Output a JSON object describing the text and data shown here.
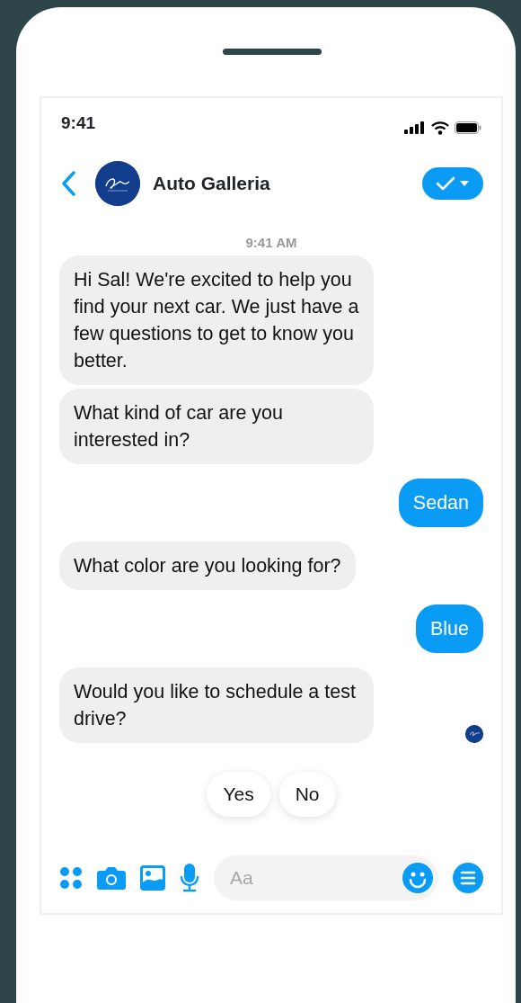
{
  "status_bar": {
    "time": "9:41"
  },
  "header": {
    "contact_name": "Auto Galleria"
  },
  "timestamp": "9:41 AM",
  "messages": [
    {
      "kind": "incoming",
      "text": "Hi Sal! We're excited to help you find your next car. We just have a few questions to get to know you better."
    },
    {
      "kind": "incoming",
      "text": "What kind of car are you interested in?"
    },
    {
      "kind": "outgoing",
      "text": "Sedan"
    },
    {
      "kind": "incoming",
      "text": "What color are you looking for?"
    },
    {
      "kind": "outgoing",
      "text": "Blue"
    },
    {
      "kind": "incoming",
      "text": "Would you like to schedule a test drive?",
      "seen": true
    }
  ],
  "quick_replies": [
    "Yes",
    "No"
  ],
  "composer": {
    "placeholder": "Aa"
  }
}
